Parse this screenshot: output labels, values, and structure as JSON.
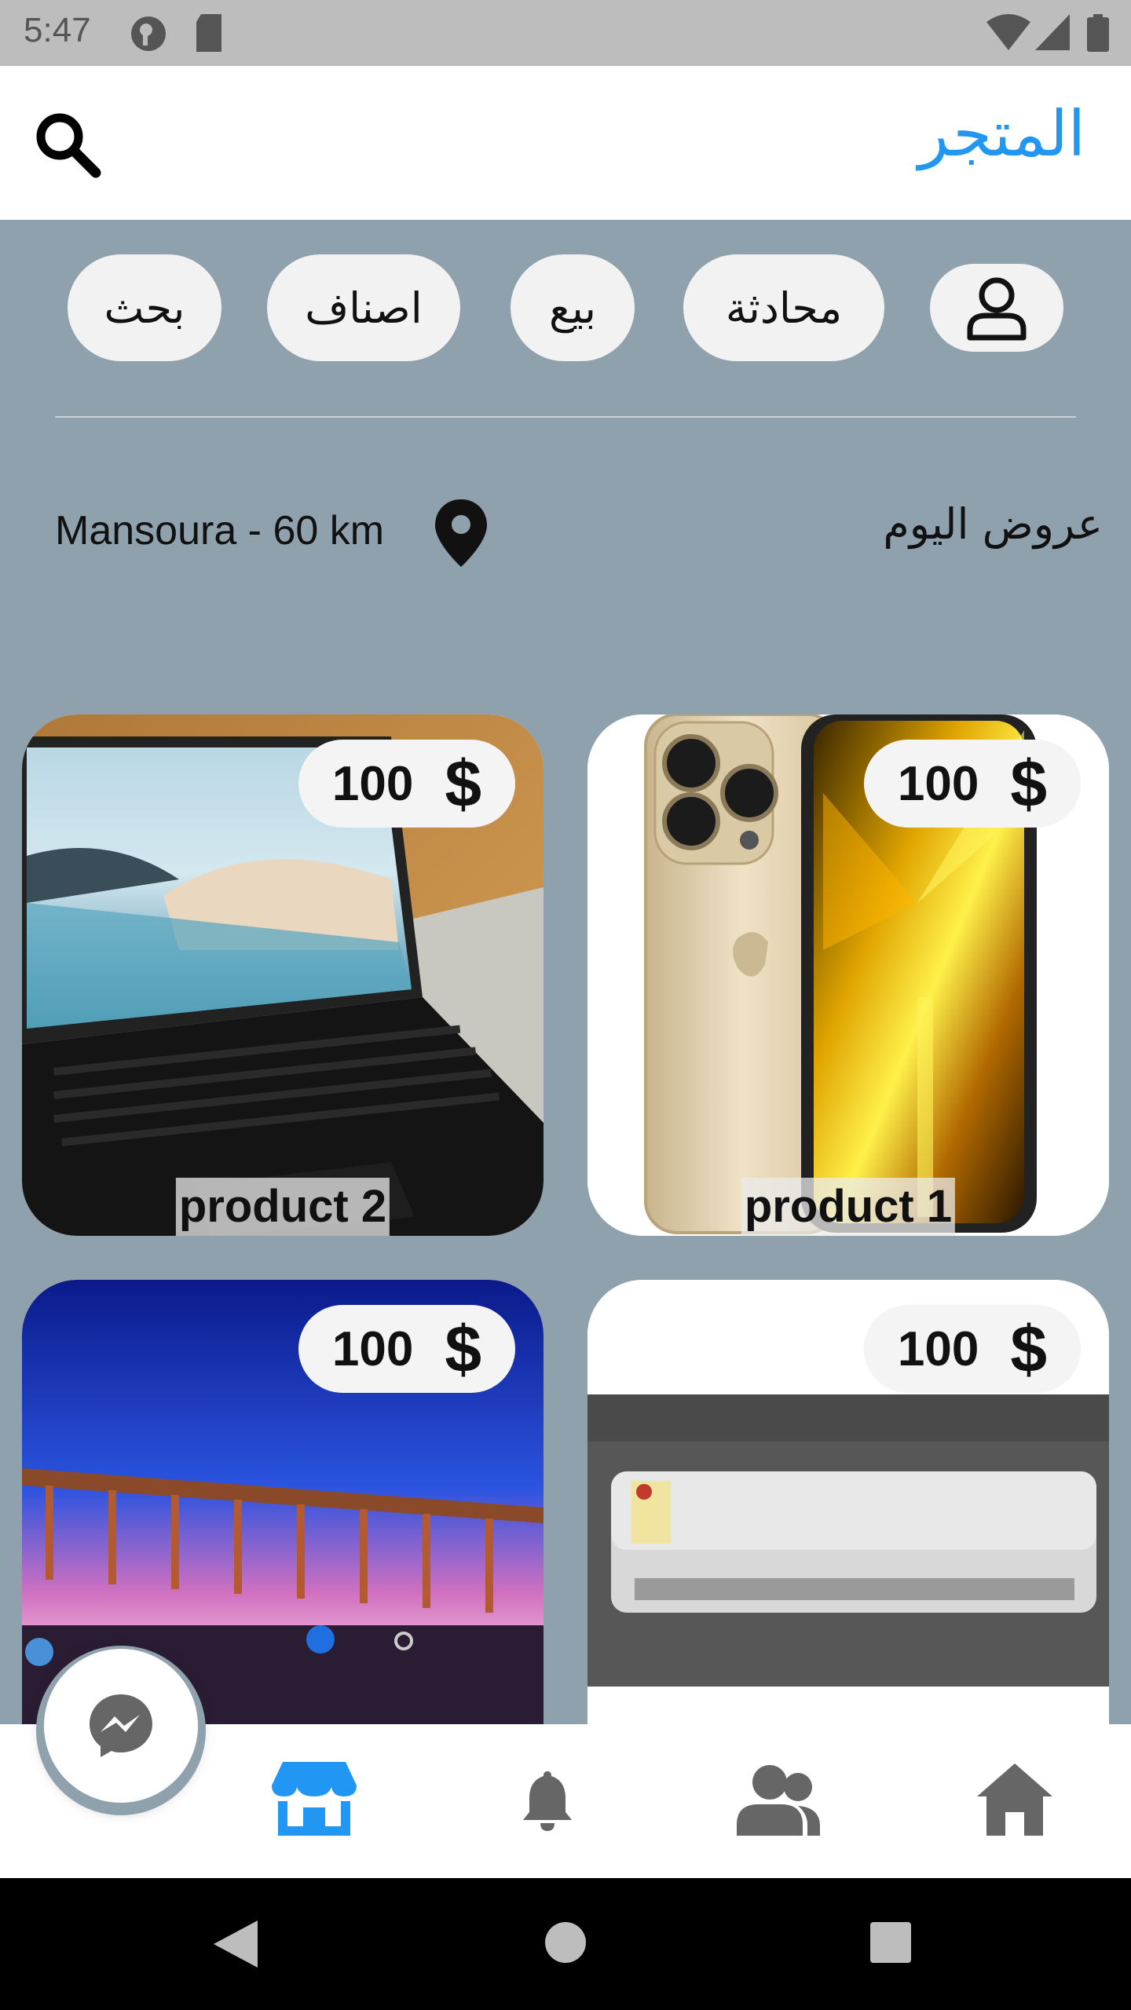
{
  "status_bar": {
    "time": "5:47"
  },
  "app_bar": {
    "title": "المتجر"
  },
  "chips": {
    "profile": "",
    "chat": "محادثة",
    "sell": "بيع",
    "categories": "اصناف",
    "search": "بحث"
  },
  "offers": {
    "title": "عروض اليوم",
    "location": "Mansoura - 60 km"
  },
  "products": [
    {
      "name": "product 1",
      "price": "100",
      "currency": "$",
      "image": "gold-iphone"
    },
    {
      "name": "product 2",
      "price": "100",
      "currency": "$",
      "image": "laptop"
    },
    {
      "name": "",
      "price": "100",
      "currency": "$",
      "image": "air-conditioner"
    },
    {
      "name": "",
      "price": "100",
      "currency": "$",
      "image": "tv-pier"
    }
  ],
  "bottom_nav": {
    "items": [
      "store-icon",
      "bell-icon",
      "people-icon",
      "home-icon"
    ],
    "active": "store-icon",
    "active_color": "#2196f3",
    "inactive_color": "#666666"
  },
  "fab": {
    "icon": "messenger-icon"
  },
  "colors": {
    "accent": "#2196f3",
    "background": "#8fa1ac"
  }
}
